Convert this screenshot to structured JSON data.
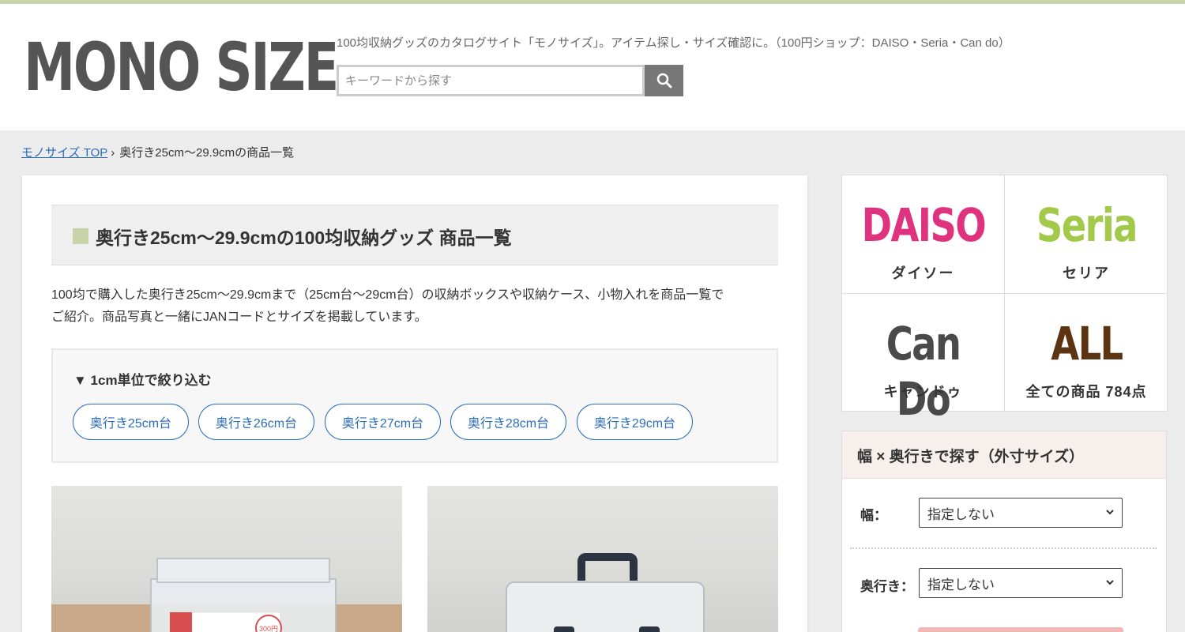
{
  "header": {
    "logo": "MONO SIZE",
    "tagline": "100均収納グッズのカタログサイト「モノサイズ」。アイテム探し・サイズ確認に。（100円ショップ：DAISO・Seria・Can do）",
    "search": {
      "placeholder": "キーワードから探す",
      "value": "",
      "button_icon": "search-icon"
    }
  },
  "breadcrumb": {
    "home": "モノサイズ TOP",
    "separator": "›",
    "current": "奥行き25cm〜29.9cmの商品一覧"
  },
  "main": {
    "heading": "奥行き25cm〜29.9cmの100均収納グッズ 商品一覧",
    "intro_line1": "100均で購入した奥行き25cm〜29.9cmまで（25cm台〜29cm台）の収納ボックスや収納ケース、小物入れを商品一覧で",
    "intro_line2": "ご紹介。商品写真と一緒にJANコードとサイズを掲載しています。",
    "filter": {
      "title": "▼ 1cm単位で絞り込む",
      "options": [
        "奥行き25cm台",
        "奥行き26cm台",
        "奥行き27cm台",
        "奥行き28cm台",
        "奥行き29cm台"
      ]
    },
    "products": [
      {
        "image": "clear-plastic-box-photo",
        "price_tag": "300円"
      },
      {
        "image": "clear-case-with-handle-photo"
      }
    ]
  },
  "sidebar": {
    "brands": [
      {
        "logo": "DAISO",
        "label": "ダイソー",
        "color": "#e0337f"
      },
      {
        "logo": "Seria",
        "label": "セリア",
        "color": "#a3c94b"
      },
      {
        "logo": "Can Do",
        "label": "キャンドゥ",
        "color": "#4a4a4a"
      },
      {
        "logo": "ALL",
        "label": "全ての商品 784点",
        "color": "#5c3411"
      }
    ],
    "size_search": {
      "title": "幅 × 奥行きで探す（外寸サイズ）",
      "width_label": "幅：",
      "width_value": "指定しない",
      "depth_label": "奥行き：",
      "depth_value": "指定しない"
    }
  },
  "colors": {
    "accent": "#c9d3a8",
    "link": "#2a6ebb",
    "logo_text": "#555555"
  }
}
